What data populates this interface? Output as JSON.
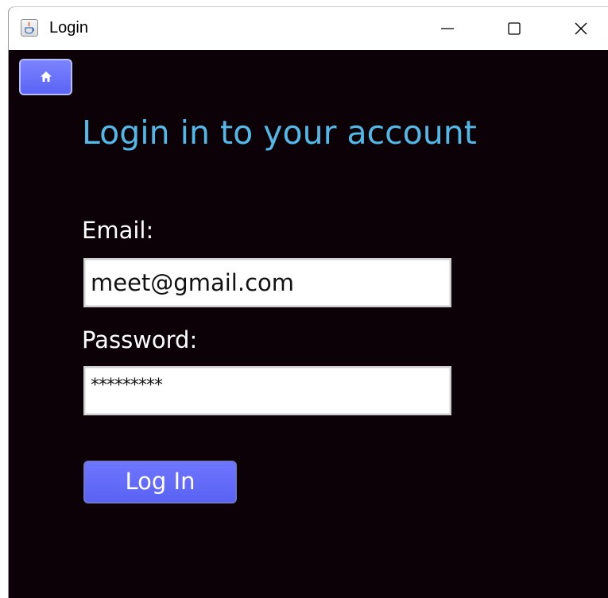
{
  "window": {
    "title": "Login",
    "controls": {
      "minimize_icon": "minimize-icon",
      "maximize_icon": "maximize-icon",
      "close_icon": "close-icon"
    }
  },
  "nav": {
    "home_icon": "home-icon"
  },
  "form": {
    "heading": "Login in to your account",
    "email_label": "Email:",
    "email_value": "meet@gmail.com",
    "password_label": "Password:",
    "password_masked": "*********",
    "submit_label": "Log In"
  },
  "colors": {
    "background": "#0b0106",
    "heading": "#54b8e6",
    "button": "#5f68f8",
    "text": "#ffffff"
  }
}
